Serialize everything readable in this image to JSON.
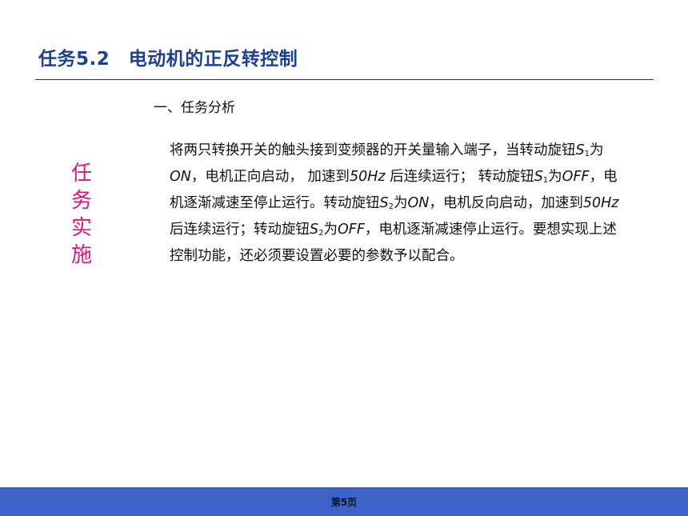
{
  "slide": {
    "title": "任务5.2　电动机的正反转控制",
    "section_heading": "一、任务分析",
    "vertical_label": "任务实施",
    "paragraph": {
      "p01": "将两只转换开关的触头接到变频器的开关量输入端子，当转动旋钮",
      "p02": "S",
      "p03": "1",
      "p04": "为",
      "p05": "ON",
      "p06": "，电机正向启动，  加速到",
      "p07": "50Hz",
      "p08": " 后连续运行；  转动旋钮",
      "p09": "S",
      "p10": "1",
      "p11": "为",
      "p12": "OFF",
      "p13": "，电机逐渐减速至停止运行。转动旋钮",
      "p14": "S",
      "p15": "2",
      "p16": "为",
      "p17": "ON",
      "p18": "，电机反向启动，加速到",
      "p19": "50Hz",
      "p20": " 后连续运行；转动旋钮",
      "p21": "S",
      "p22": "2",
      "p23": "为",
      "p24": "OFF",
      "p25": "，电机逐渐减速停止运行。要想实现上述控制功能，还必须要设置必要的参数予以配合。"
    },
    "page_number": "第5页"
  },
  "colors": {
    "title": "#1f3f8f",
    "vertical_label": "#e0157a",
    "footer_bar": "#3d63c9"
  }
}
